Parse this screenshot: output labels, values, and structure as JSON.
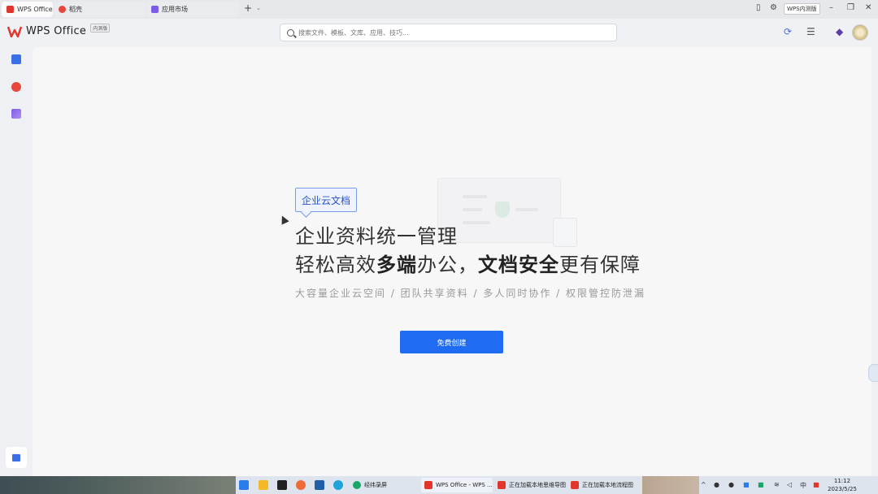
{
  "tabs": [
    {
      "label": "WPS Office",
      "active": true
    },
    {
      "label": "稻壳",
      "active": false
    },
    {
      "label": "应用市场",
      "active": false
    }
  ],
  "top_bar": {
    "beta_badge": "WPS内测版",
    "add_tab": "+",
    "tab_list": "⌄"
  },
  "header": {
    "logo_text": "WPS Office",
    "logo_badge": "内测版",
    "search_placeholder": "搜索文件、模板、文库、应用、技巧..."
  },
  "promo": {
    "tag": "企业云文档",
    "headline1": "企业资料统一管理",
    "headline2_part1": "轻松高效",
    "headline2_bold1": "多端",
    "headline2_part2": "办公，",
    "headline2_bold2": "文档安全",
    "headline2_part3": "更有保障",
    "subline": "大容量企业云空间 / 团队共享资料 / 多人同时协作 / 权限管控防泄漏",
    "cta": "免费创建"
  },
  "taskbar": {
    "apps": [
      {
        "label": "经纬录屏"
      },
      {
        "label": "WPS Office - WPS ..."
      },
      {
        "label": "正在加载本地思维导图"
      },
      {
        "label": "正在加载本地流程图"
      }
    ],
    "time": "11:12",
    "date": "2023/5/25"
  },
  "colors": {
    "accent": "#1f6cf2",
    "brand_red": "#e0362b",
    "tag_blue": "#2653c9"
  }
}
